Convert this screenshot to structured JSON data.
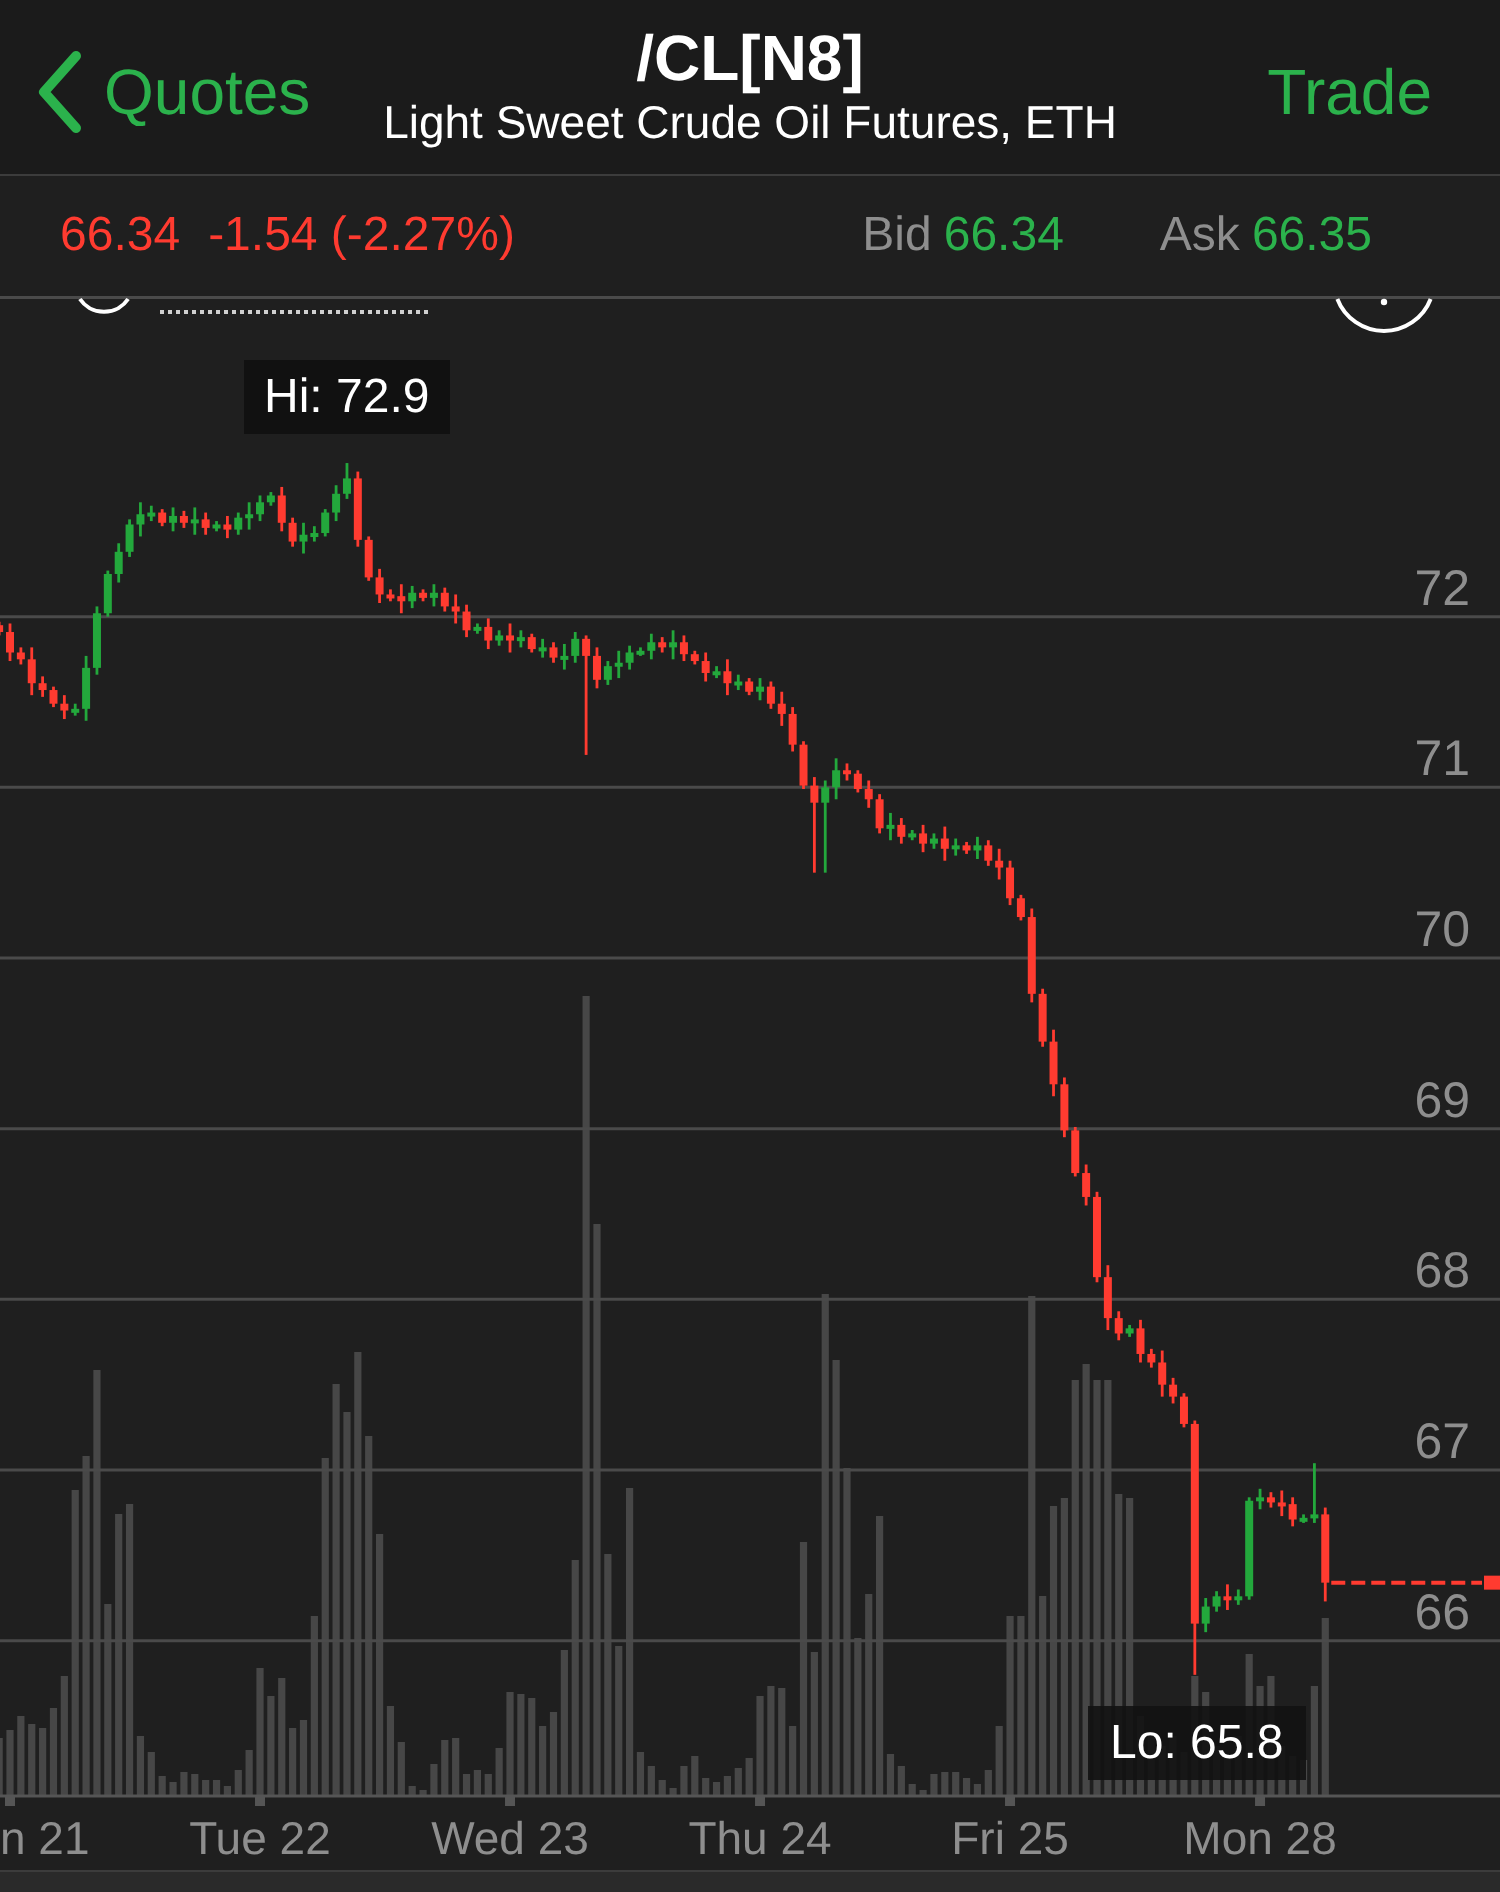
{
  "nav": {
    "back_label": "Quotes",
    "title": "/CL[N8]",
    "subtitle": "Light Sweet Crude Oil Futures, ETH",
    "action_label": "Trade"
  },
  "quote": {
    "last": "66.34",
    "change": "-1.54 (-2.27%)",
    "bid_label": "Bid",
    "bid": "66.34",
    "ask_label": "Ask",
    "ask": "66.35"
  },
  "chart": {
    "high_label": "Hi: 72.9",
    "low_label": "Lo: 65.8",
    "partial_date_label": "n 21",
    "chart_data": {
      "type": "candlestick",
      "grid": true,
      "ylim": [
        65.09,
        73.87
      ],
      "yticks": [
        {
          "value": 72,
          "label": "72"
        },
        {
          "value": 71,
          "label": "71"
        },
        {
          "value": 70,
          "label": "70"
        },
        {
          "value": 69,
          "label": "69"
        },
        {
          "value": 68,
          "label": "68"
        },
        {
          "value": 67,
          "label": "67"
        },
        {
          "value": 66,
          "label": "66"
        }
      ],
      "categories": [
        null,
        null,
        null,
        null,
        null,
        null,
        null,
        null,
        null,
        null,
        null,
        null,
        null,
        null,
        null,
        null,
        null,
        null,
        null,
        null,
        null,
        null,
        null,
        null,
        "Tue 22",
        null,
        null,
        null,
        null,
        null,
        null,
        null,
        null,
        null,
        null,
        null,
        null,
        null,
        null,
        null,
        null,
        null,
        null,
        null,
        null,
        null,
        null,
        "Wed 23",
        null,
        null,
        null,
        null,
        null,
        null,
        null,
        null,
        null,
        null,
        null,
        null,
        null,
        null,
        null,
        null,
        null,
        null,
        null,
        null,
        null,
        null,
        "Thu 24",
        null,
        null,
        null,
        null,
        null,
        null,
        null,
        null,
        null,
        null,
        null,
        null,
        null,
        null,
        null,
        null,
        null,
        null,
        null,
        null,
        null,
        null,
        "Fri 25",
        null,
        null,
        null,
        null,
        null,
        null,
        null,
        null,
        null,
        null,
        null,
        null,
        null,
        null,
        null,
        null,
        null,
        null,
        null,
        null,
        null,
        null,
        "Mon 28",
        null,
        null,
        null,
        null,
        null,
        null
      ],
      "ohlc": [
        [
          71.95,
          71.97,
          71.89,
          71.91
        ],
        [
          71.91,
          71.96,
          71.74,
          71.79
        ],
        [
          71.79,
          71.82,
          71.72,
          71.75
        ],
        [
          71.75,
          71.82,
          71.54,
          71.61
        ],
        [
          71.61,
          71.65,
          71.53,
          71.57
        ],
        [
          71.57,
          71.59,
          71.47,
          71.49
        ],
        [
          71.49,
          71.54,
          71.4,
          71.45
        ],
        [
          71.45,
          71.49,
          71.42,
          71.46
        ],
        [
          71.46,
          71.77,
          71.39,
          71.7
        ],
        [
          71.7,
          72.06,
          71.66,
          72.02
        ],
        [
          72.02,
          72.27,
          72.0,
          72.25
        ],
        [
          72.25,
          72.43,
          72.2,
          72.38
        ],
        [
          72.38,
          72.57,
          72.35,
          72.54
        ],
        [
          72.54,
          72.67,
          72.47,
          72.6
        ],
        [
          72.6,
          72.65,
          72.56,
          72.61
        ],
        [
          72.61,
          72.63,
          72.53,
          72.55
        ],
        [
          72.55,
          72.64,
          72.5,
          72.59
        ],
        [
          72.59,
          72.62,
          72.52,
          72.55
        ],
        [
          72.55,
          72.64,
          72.48,
          72.57
        ],
        [
          72.57,
          72.61,
          72.48,
          72.52
        ],
        [
          72.52,
          72.56,
          72.5,
          72.54
        ],
        [
          72.54,
          72.59,
          72.46,
          72.51
        ],
        [
          72.51,
          72.61,
          72.48,
          72.58
        ],
        [
          72.58,
          72.67,
          72.51,
          72.6
        ],
        [
          72.6,
          72.71,
          72.56,
          72.67
        ],
        [
          72.67,
          72.73,
          72.65,
          72.71
        ],
        [
          72.71,
          72.76,
          72.5,
          72.55
        ],
        [
          72.55,
          72.58,
          72.41,
          72.44
        ],
        [
          72.44,
          72.55,
          72.37,
          72.48
        ],
        [
          72.48,
          72.53,
          72.44,
          72.49
        ],
        [
          72.49,
          72.63,
          72.47,
          72.61
        ],
        [
          72.61,
          72.77,
          72.56,
          72.72
        ],
        [
          72.72,
          72.9,
          72.69,
          72.81
        ],
        [
          72.81,
          72.85,
          72.41,
          72.45
        ],
        [
          72.45,
          72.47,
          72.21,
          72.23
        ],
        [
          72.23,
          72.28,
          72.08,
          72.13
        ],
        [
          72.13,
          72.16,
          72.09,
          72.12
        ],
        [
          72.12,
          72.19,
          72.02,
          72.09
        ],
        [
          72.09,
          72.18,
          72.05,
          72.14
        ],
        [
          72.14,
          72.16,
          72.09,
          72.11
        ],
        [
          72.11,
          72.19,
          72.06,
          72.14
        ],
        [
          72.14,
          72.17,
          72.03,
          72.06
        ],
        [
          72.06,
          72.13,
          71.96,
          72.03
        ],
        [
          72.03,
          72.07,
          71.88,
          71.92
        ],
        [
          71.92,
          71.96,
          71.9,
          71.94
        ],
        [
          71.94,
          71.99,
          71.81,
          71.86
        ],
        [
          71.86,
          71.92,
          71.83,
          71.89
        ],
        [
          71.89,
          71.96,
          71.79,
          71.86
        ],
        [
          71.86,
          71.92,
          71.82,
          71.88
        ],
        [
          71.88,
          71.9,
          71.79,
          71.81
        ],
        [
          71.81,
          71.87,
          71.76,
          71.82
        ],
        [
          71.82,
          71.85,
          71.73,
          71.76
        ],
        [
          71.76,
          71.84,
          71.69,
          71.77
        ],
        [
          71.77,
          71.91,
          71.73,
          71.87
        ],
        [
          71.87,
          71.89,
          71.19,
          71.77
        ],
        [
          71.77,
          71.82,
          71.58,
          71.63
        ],
        [
          71.63,
          71.74,
          71.6,
          71.71
        ],
        [
          71.71,
          71.8,
          71.64,
          71.73
        ],
        [
          71.73,
          71.83,
          71.69,
          71.79
        ],
        [
          71.79,
          71.82,
          71.77,
          71.8
        ],
        [
          71.8,
          71.9,
          71.75,
          71.85
        ],
        [
          71.85,
          71.88,
          71.79,
          71.82
        ],
        [
          71.82,
          71.92,
          71.75,
          71.85
        ],
        [
          71.85,
          71.89,
          71.74,
          71.78
        ],
        [
          71.78,
          71.8,
          71.72,
          71.74
        ],
        [
          71.74,
          71.79,
          71.62,
          71.67
        ],
        [
          71.67,
          71.71,
          71.64,
          71.68
        ],
        [
          71.68,
          71.75,
          71.54,
          71.61
        ],
        [
          71.61,
          71.66,
          71.57,
          71.62
        ],
        [
          71.62,
          71.64,
          71.54,
          71.56
        ],
        [
          71.56,
          71.64,
          71.51,
          71.59
        ],
        [
          71.59,
          71.62,
          71.46,
          71.49
        ],
        [
          71.49,
          71.56,
          71.36,
          71.43
        ],
        [
          71.43,
          71.47,
          71.21,
          71.25
        ],
        [
          71.25,
          71.27,
          70.99,
          71.01
        ],
        [
          71.01,
          71.06,
          70.5,
          70.91
        ],
        [
          70.91,
          71.04,
          70.5,
          71.0
        ],
        [
          71.0,
          71.17,
          70.93,
          71.1
        ],
        [
          71.1,
          71.14,
          71.04,
          71.08
        ],
        [
          71.08,
          71.1,
          70.97,
          70.99
        ],
        [
          70.99,
          71.04,
          70.88,
          70.93
        ],
        [
          70.93,
          70.96,
          70.73,
          70.76
        ],
        [
          70.76,
          70.85,
          70.69,
          70.78
        ],
        [
          70.78,
          70.82,
          70.67,
          70.71
        ],
        [
          70.71,
          70.75,
          70.69,
          70.73
        ],
        [
          70.73,
          70.78,
          70.62,
          70.67
        ],
        [
          70.67,
          70.73,
          70.64,
          70.7
        ],
        [
          70.7,
          70.77,
          70.57,
          70.64
        ],
        [
          70.64,
          70.7,
          70.6,
          70.66
        ],
        [
          70.66,
          70.68,
          70.61,
          70.63
        ],
        [
          70.63,
          70.71,
          70.58,
          70.66
        ],
        [
          70.66,
          70.69,
          70.54,
          70.57
        ],
        [
          70.57,
          70.64,
          70.46,
          70.53
        ],
        [
          70.53,
          70.57,
          70.31,
          70.35
        ],
        [
          70.35,
          70.37,
          70.22,
          70.24
        ],
        [
          70.24,
          70.29,
          69.74,
          69.79
        ],
        [
          69.79,
          69.82,
          69.48,
          69.51
        ],
        [
          69.51,
          69.58,
          69.19,
          69.26
        ],
        [
          69.26,
          69.3,
          68.95,
          68.99
        ],
        [
          68.99,
          69.01,
          68.72,
          68.74
        ],
        [
          68.74,
          68.79,
          68.55,
          68.6
        ],
        [
          68.6,
          68.63,
          68.1,
          68.13
        ],
        [
          68.13,
          68.2,
          67.82,
          67.89
        ],
        [
          67.89,
          67.93,
          67.76,
          67.8
        ],
        [
          67.8,
          67.85,
          67.78,
          67.83
        ],
        [
          67.83,
          67.88,
          67.63,
          67.68
        ],
        [
          67.68,
          67.71,
          67.6,
          67.63
        ],
        [
          67.63,
          67.7,
          67.43,
          67.5
        ],
        [
          67.5,
          67.54,
          67.39,
          67.43
        ],
        [
          67.43,
          67.45,
          67.25,
          67.27
        ],
        [
          67.27,
          67.29,
          65.8,
          66.1
        ],
        [
          66.1,
          66.25,
          66.05,
          66.2
        ],
        [
          66.2,
          66.29,
          66.17,
          66.26
        ],
        [
          66.26,
          66.33,
          66.18,
          66.25
        ],
        [
          66.25,
          66.3,
          66.21,
          66.26
        ],
        [
          66.26,
          66.84,
          66.24,
          66.82
        ],
        [
          66.82,
          66.89,
          66.77,
          66.84
        ],
        [
          66.84,
          66.87,
          66.78,
          66.81
        ],
        [
          66.81,
          66.88,
          66.73,
          66.8
        ],
        [
          66.8,
          66.84,
          66.67,
          66.71
        ],
        [
          66.71,
          66.74,
          66.69,
          66.72
        ],
        [
          66.72,
          67.04,
          66.69,
          66.74
        ],
        [
          66.74,
          66.78,
          66.23,
          66.34
        ]
      ]
    }
  }
}
